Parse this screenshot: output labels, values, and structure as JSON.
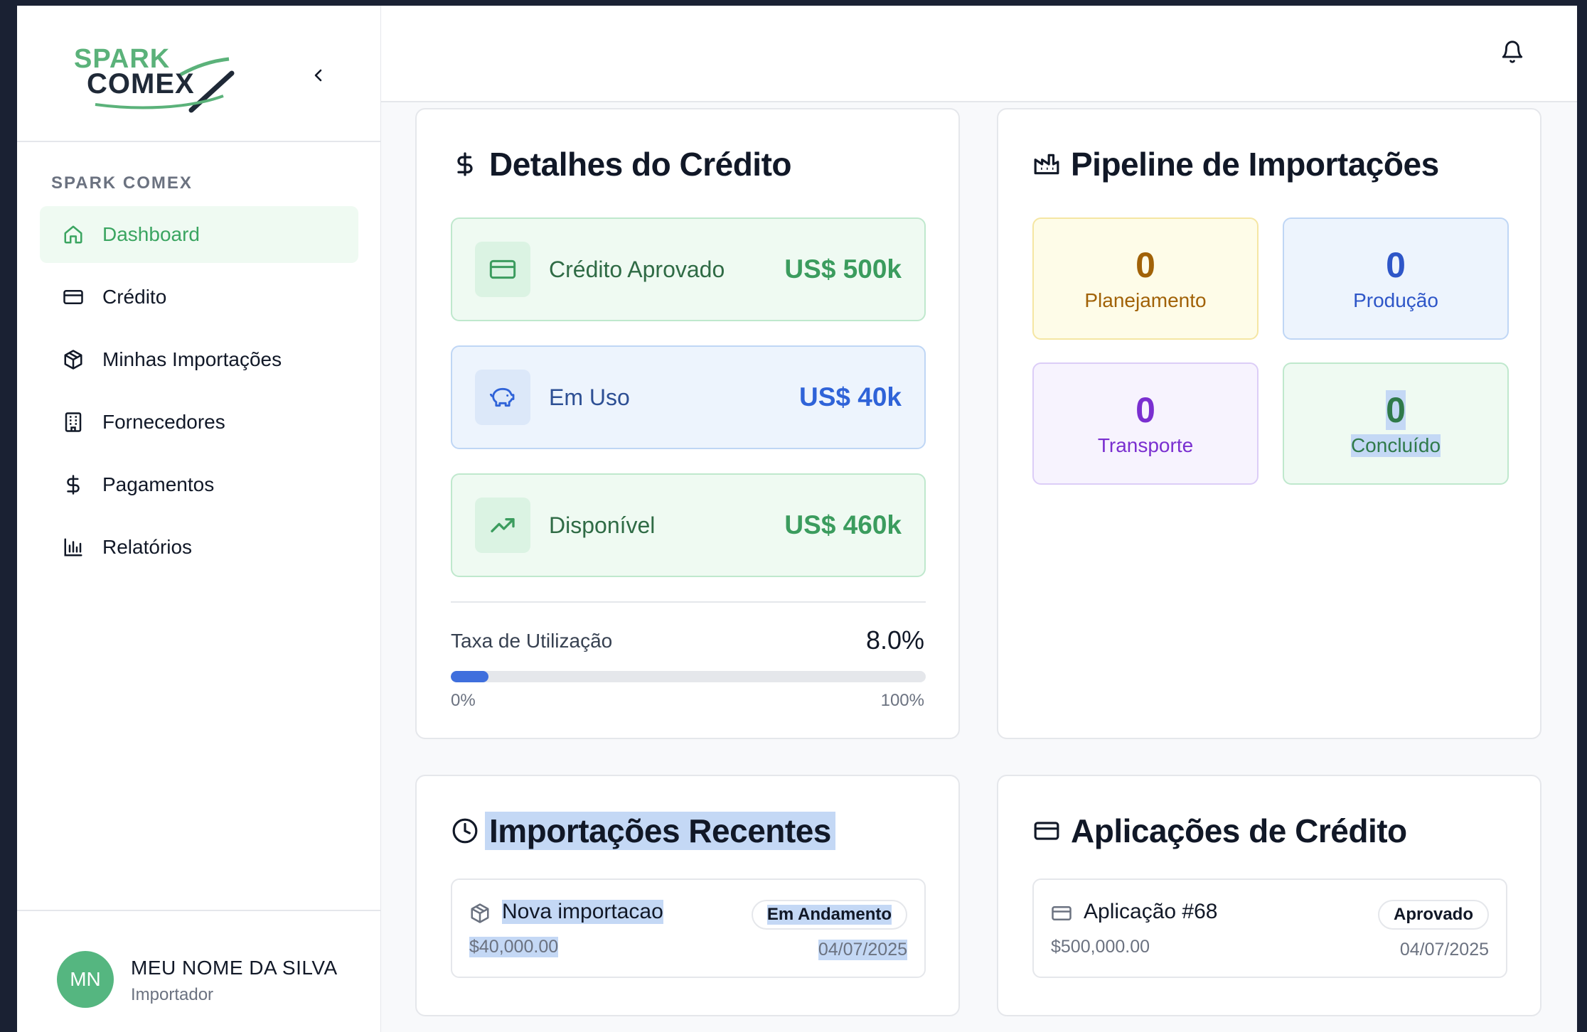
{
  "brand": {
    "logo_top": "SPARK",
    "logo_bottom": "COMEX",
    "section_label": "SPARK COMEX"
  },
  "nav": {
    "items": [
      {
        "label": "Dashboard",
        "icon": "home-icon",
        "active": true
      },
      {
        "label": "Crédito",
        "icon": "credit-card-icon",
        "active": false
      },
      {
        "label": "Minhas Importações",
        "icon": "package-icon",
        "active": false
      },
      {
        "label": "Fornecedores",
        "icon": "building-icon",
        "active": false
      },
      {
        "label": "Pagamentos",
        "icon": "dollar-icon",
        "active": false
      },
      {
        "label": "Relatórios",
        "icon": "bar-chart-icon",
        "active": false
      }
    ]
  },
  "user": {
    "initials": "MN",
    "name": "MEU NOME DA SILVA",
    "role": "Importador"
  },
  "credit": {
    "title": "Detalhes do Crédito",
    "rows": [
      {
        "label": "Crédito Aprovado",
        "amount": "US$ 500k",
        "icon": "credit-card-icon",
        "tone": "green"
      },
      {
        "label": "Em Uso",
        "amount": "US$ 40k",
        "icon": "piggy-bank-icon",
        "tone": "blue"
      },
      {
        "label": "Disponível",
        "amount": "US$ 460k",
        "icon": "trending-up-icon",
        "tone": "green"
      }
    ],
    "utilization_label": "Taxa de Utilização",
    "utilization_value": "8.0%",
    "utilization_fraction": 0.08,
    "min_label": "0%",
    "max_label": "100%"
  },
  "pipeline": {
    "title": "Pipeline de Importações",
    "stages": [
      {
        "count": "0",
        "name": "Planejamento",
        "tone": "yellow"
      },
      {
        "count": "0",
        "name": "Produção",
        "tone": "blue"
      },
      {
        "count": "0",
        "name": "Transporte",
        "tone": "purple"
      },
      {
        "count": "0",
        "name": "Concluído",
        "tone": "green"
      }
    ]
  },
  "recent_imports": {
    "title": "Importações Recentes",
    "items": [
      {
        "title": "Nova importacao",
        "amount": "$40,000.00",
        "status": "Em Andamento",
        "date": "04/07/2025"
      }
    ]
  },
  "credit_applications": {
    "title": "Aplicações de Crédito",
    "items": [
      {
        "title": "Aplicação #68",
        "amount": "$500,000.00",
        "status": "Aprovado",
        "date": "04/07/2025"
      }
    ]
  },
  "colors": {
    "accent_green": "#3ba561",
    "accent_blue": "#2f63d8",
    "progress": "#3f6fdd"
  }
}
